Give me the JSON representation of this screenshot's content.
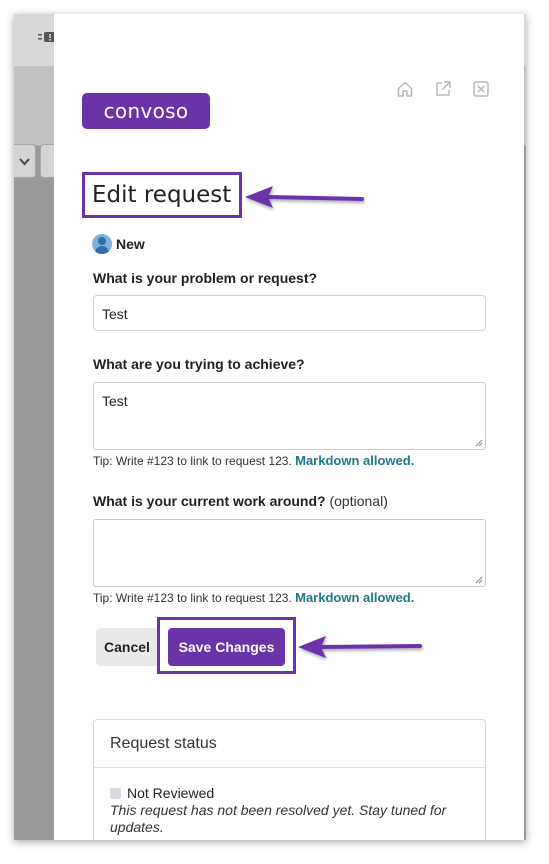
{
  "brand": {
    "logo_text": "convoso",
    "accent": "#6c33a8",
    "link_color": "#1f7a86"
  },
  "panel": {
    "icons": [
      "home-icon",
      "open-external-icon",
      "close-icon"
    ]
  },
  "form": {
    "title": "Edit request",
    "status": "New",
    "problem": {
      "label": "What is your problem or request?",
      "value": "Test"
    },
    "achieve": {
      "label": "What are you trying to achieve?",
      "value": "Test"
    },
    "workaround": {
      "label": "What is your current work around?",
      "optional": "(optional)",
      "value": ""
    },
    "tip_text": "Tip: Write #123 to link to request 123.",
    "markdown_text": "Markdown allowed.",
    "cancel_label": "Cancel",
    "save_label": "Save Changes"
  },
  "request_status": {
    "header": "Request status",
    "status": "Not Reviewed",
    "description": "This request has not been resolved yet. Stay tuned for updates."
  }
}
